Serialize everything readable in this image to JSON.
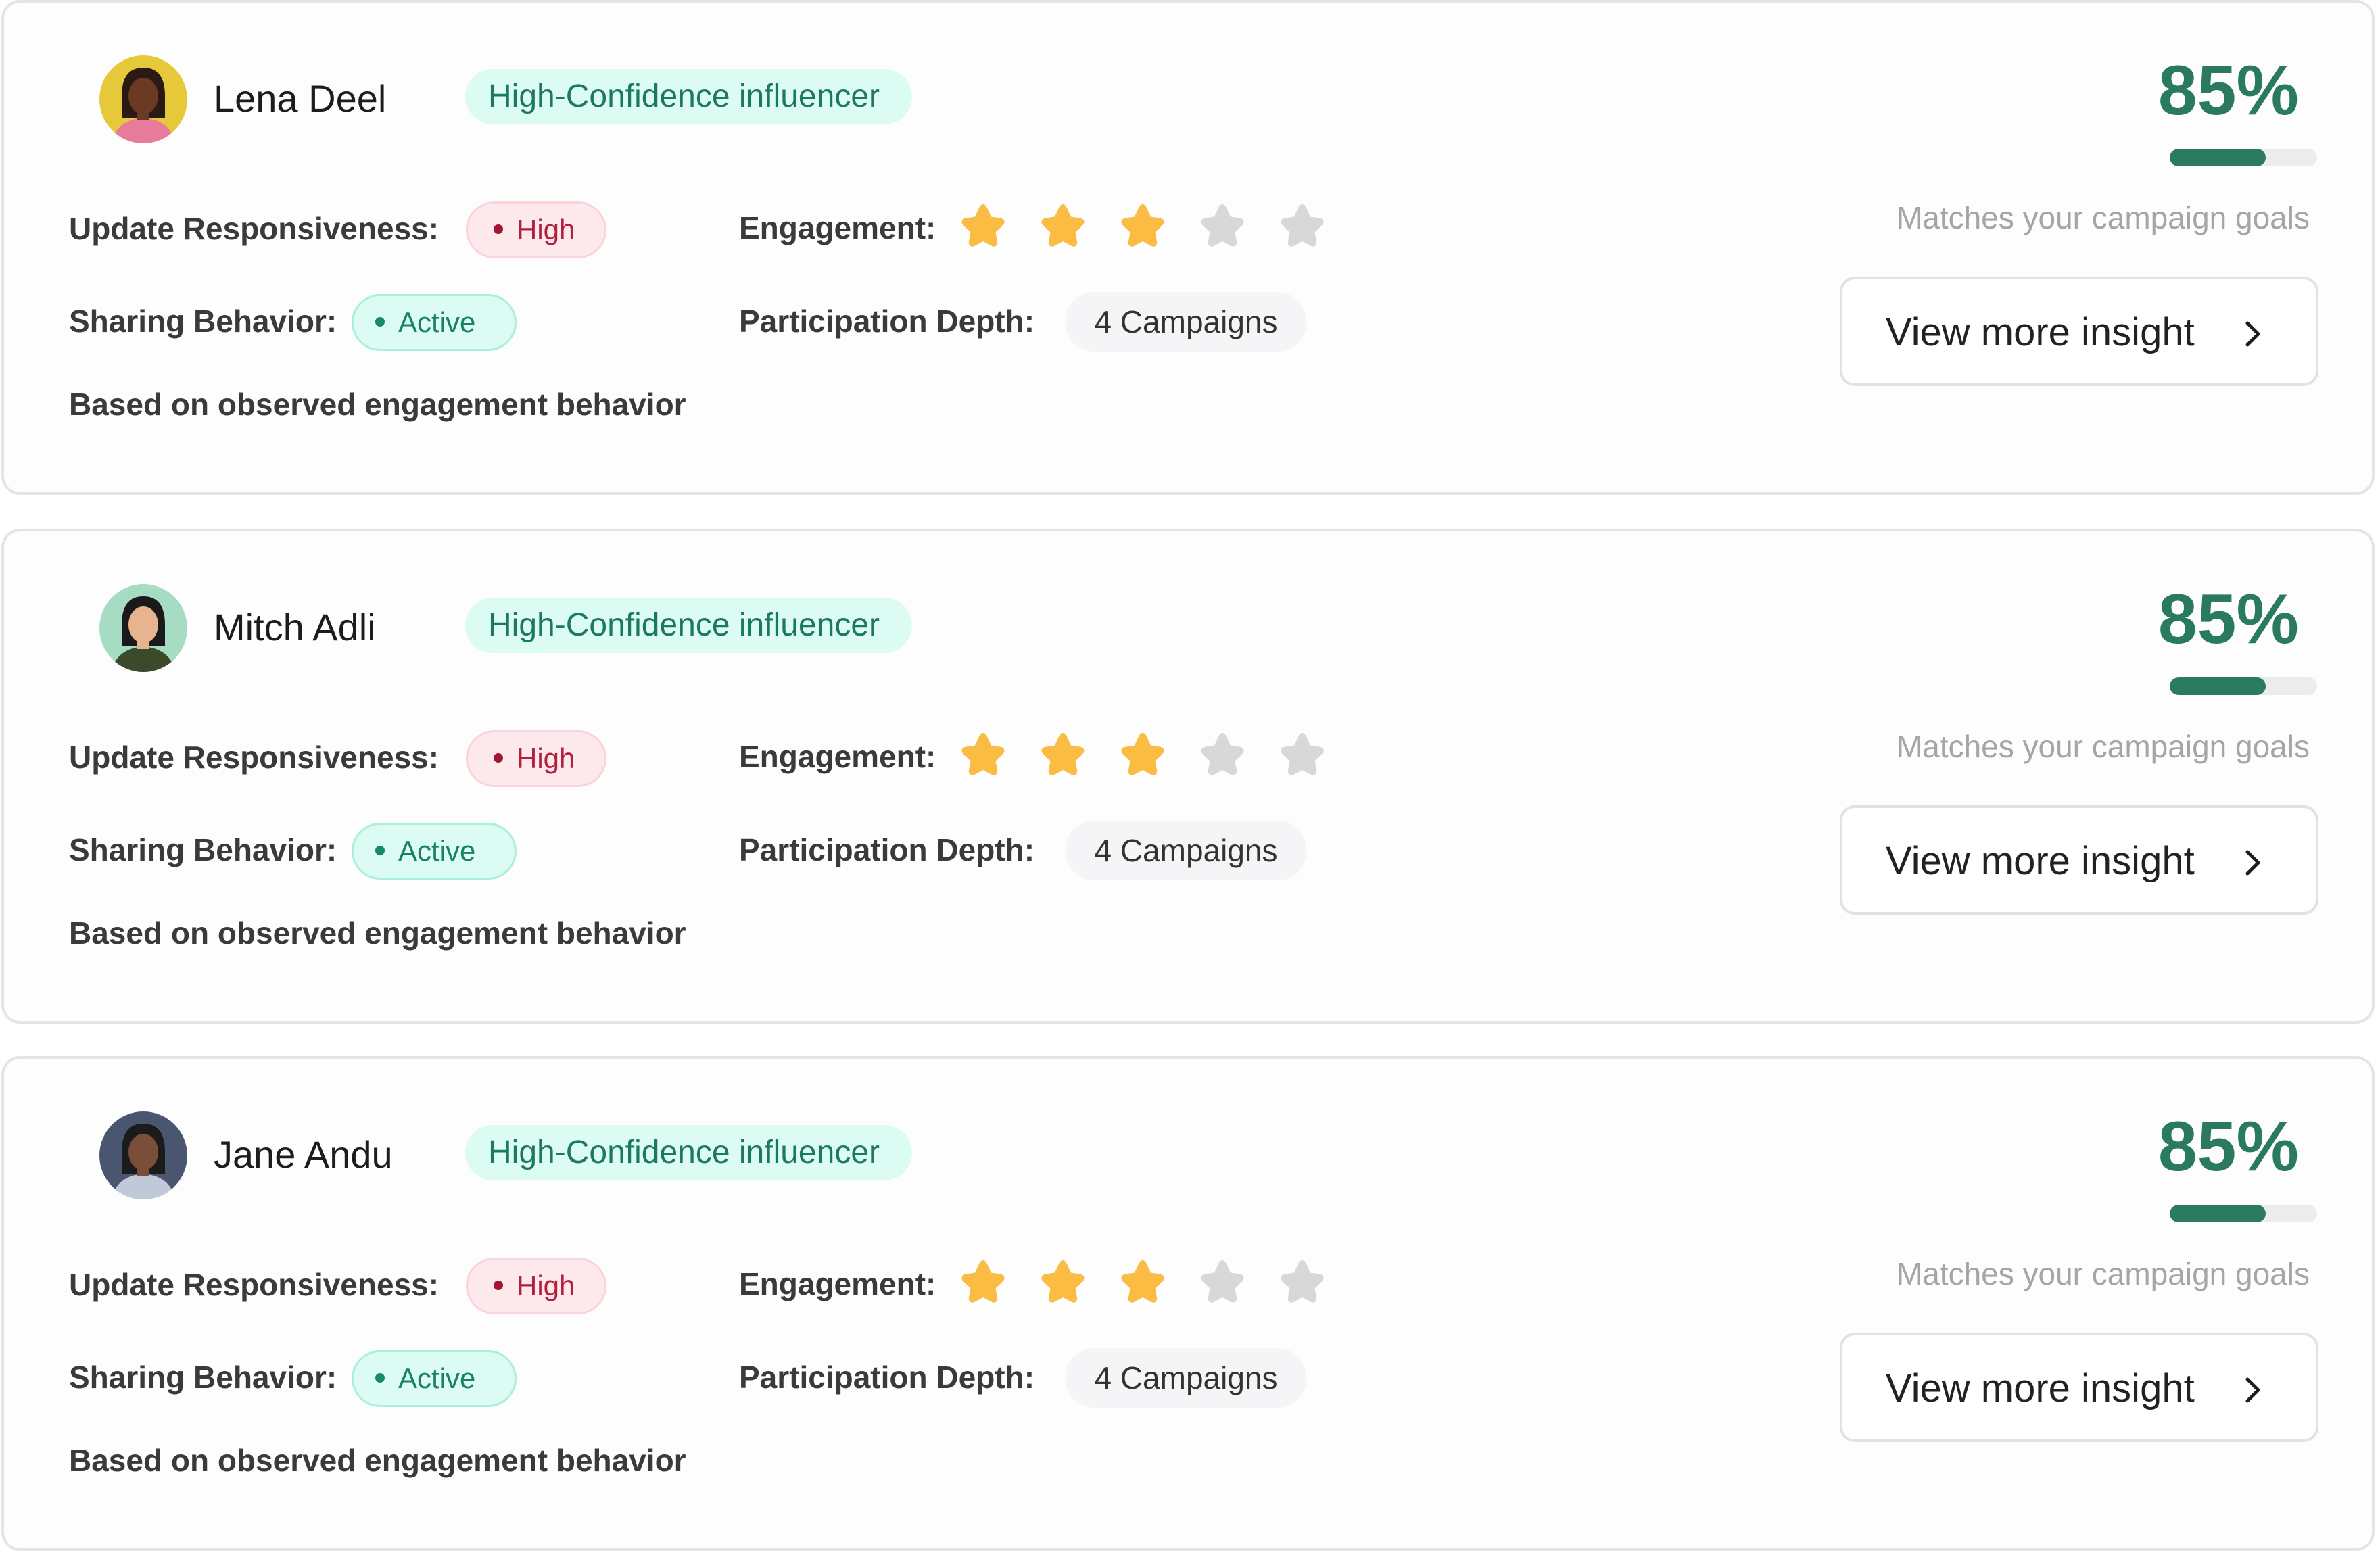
{
  "influencers": [
    {
      "name": "Mitch Adli",
      "tag": "High-Confidence influencer",
      "avatar": {
        "bg": "#a6dcc4",
        "skin": "#e8b48f",
        "hair": "#1a1a1a",
        "shirt": "#3a4a2a"
      },
      "responsiveness_label": "Update Responsiveness:",
      "responsiveness": "High",
      "sharing_label": "Sharing Behavior:",
      "sharing": "Active",
      "engagement_label": "Engagement:",
      "engagement_rating": 3,
      "engagement_max": 5,
      "depth_label": "Participation Depth:",
      "depth": "4 Campaigns",
      "basis": "Based on observed engagement behavior",
      "match_percent": "85%",
      "match_fraction": 0.65,
      "match_caption": "Matches your campaign goals",
      "button_label": "View more insight"
    },
    {
      "name": "Jane Andu",
      "tag": "High-Confidence influencer",
      "avatar": {
        "bg": "#4a5570",
        "skin": "#7a4f3a",
        "hair": "#1b1b1b",
        "shirt": "#bfc9d8"
      },
      "responsiveness_label": "Update Responsiveness:",
      "responsiveness": "High",
      "sharing_label": "Sharing Behavior:",
      "sharing": "Active",
      "engagement_label": "Engagement:",
      "engagement_rating": 3,
      "engagement_max": 5,
      "depth_label": "Participation Depth:",
      "depth": "4 Campaigns",
      "basis": "Based on observed engagement behavior",
      "match_percent": "85%",
      "match_fraction": 0.65,
      "match_caption": "Matches your campaign goals",
      "button_label": "View more insight"
    },
    {
      "name": "Lena Deel",
      "tag": "High-Confidence influencer",
      "avatar": {
        "bg": "#e6c93a",
        "skin": "#6a3a24",
        "hair": "#2a1a12",
        "shirt": "#e87a9a"
      },
      "responsiveness_label": "Update Responsiveness:",
      "responsiveness": "High",
      "sharing_label": "Sharing Behavior:",
      "sharing": "Active",
      "engagement_label": "Engagement:",
      "engagement_rating": 3,
      "engagement_max": 5,
      "depth_label": "Participation Depth:",
      "depth": "4 Campaigns",
      "basis": "Based on observed engagement behavior",
      "match_percent": "85%",
      "match_fraction": 0.65,
      "match_caption": "Matches your campaign goals",
      "button_label": "View more insight"
    }
  ],
  "icons": {
    "star": "star-icon",
    "chevron": "chevron-right-icon",
    "dot": "status-dot-icon"
  },
  "colors": {
    "accent": "#2a7a62",
    "star_on": "#fbbc43",
    "star_off": "#d8d8d8",
    "high": "#b1213e",
    "active": "#17806a"
  }
}
